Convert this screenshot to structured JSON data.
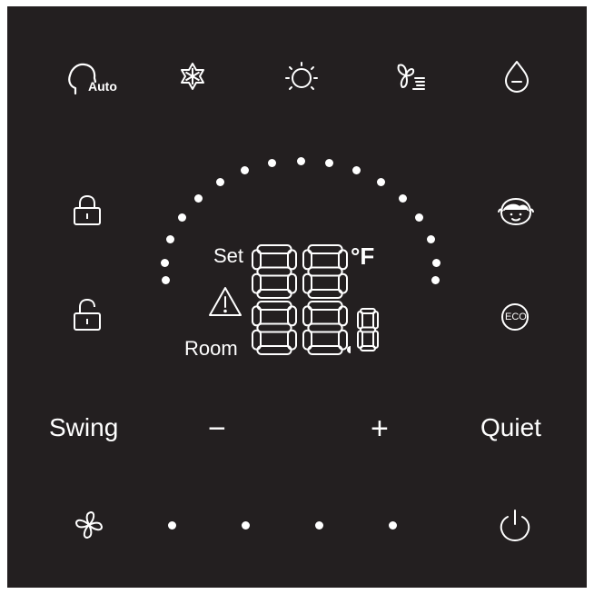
{
  "colors": {
    "panel_bg": "#231f20",
    "foreground": "#ffffff",
    "page_bg": "#ffffff"
  },
  "mode_icons": [
    "auto-mode-icon",
    "cool-mode-icon",
    "heat-mode-icon",
    "fan-mode-icon",
    "dry-mode-icon"
  ],
  "auto_label": "Auto",
  "left_icons": [
    "lock-icon",
    "unlock-icon"
  ],
  "right_icons": [
    "sleep-face-icon",
    "eco-icon"
  ],
  "eco_label": "ECO",
  "display": {
    "set_label": "Set",
    "room_label": "Room",
    "unit": "°F",
    "main_digits": "88",
    "room_digits": "88",
    "room_decimal": "8",
    "warning_icon": "warning-triangle-icon"
  },
  "controls": {
    "swing_label": "Swing",
    "minus_label": "−",
    "plus_label": "+",
    "quiet_label": "Quiet"
  },
  "bottom_icons": [
    "fan-speed-icon",
    "power-icon"
  ],
  "arc_indicator_count": 17,
  "fan_speed_indicator_count": 4
}
